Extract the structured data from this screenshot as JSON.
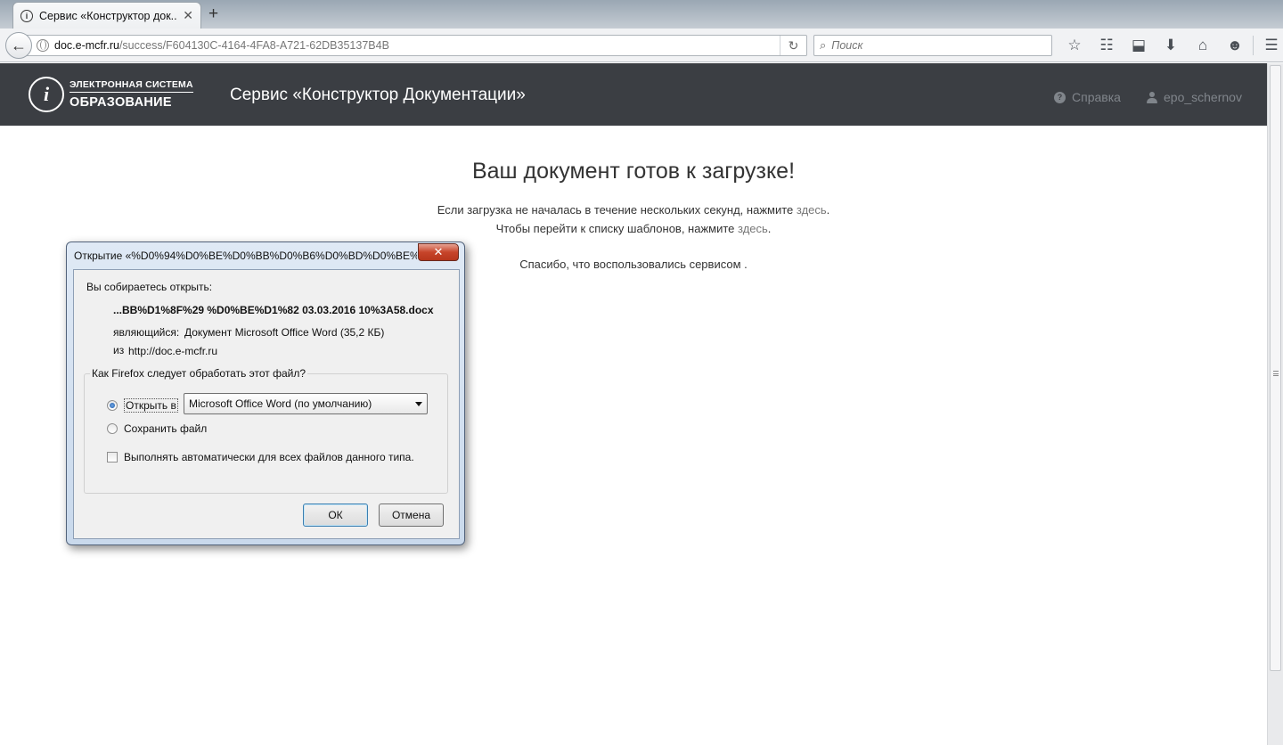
{
  "browser": {
    "tab_title": "Сервис «Конструктор док...",
    "tab_close": "✕",
    "new_tab": "+",
    "url_host": "doc.e-mcfr.ru",
    "url_path": "/success/F604130C-4164-4FA8-A721-62DB35137B4B",
    "search_placeholder": "Поиск",
    "icons": [
      "bookmark-star-icon",
      "reading-list-icon",
      "pocket-icon",
      "download-icon",
      "home-icon",
      "chat-icon",
      "menu-icon"
    ]
  },
  "header": {
    "logo_line1": "ЭЛЕКТРОННАЯ СИСТЕМА",
    "logo_line2": "ОБРАЗОВАНИЕ",
    "logo_mark": "i",
    "site_title": "Сервис «Конструктор Документации»",
    "help_label": "Справка",
    "user_label": "epo_schernov",
    "background": "#3b3e43"
  },
  "main": {
    "heading": "Ваш документ готов к загрузке!",
    "line1_text": "Если загрузка не началась в течение нескольких секунд, нажмите",
    "line1_link": "здесь",
    "line2_text": "Чтобы перейти к списку шаблонов, нажмите",
    "line2_link": "здесь",
    "line3_text": "Спасибо, что воспользовались сервисом ."
  },
  "dialog": {
    "title": "Открытие «%D0%94%D0%BE%D0%BB%D0%B6%D0%BD%D0%BE%D1...",
    "close": "✕",
    "intro": "Вы собираетесь открыть:",
    "filename": "...BB%D1%8F%29 %D0%BE%D1%82 03.03.2016 10%3A58.docx",
    "type_label": "являющийся:",
    "type_value": "Документ Microsoft Office Word (35,2 КБ)",
    "from_label": "из",
    "from_value": "http://doc.e-mcfr.ru",
    "group_legend": "Как Firefox следует обработать этот файл?",
    "open_with_label": "Открыть в",
    "open_with_value": "Microsoft Office Word (по умолчанию)",
    "save_label": "Сохранить файл",
    "auto_label": "Выполнять автоматически для всех файлов данного типа.",
    "ok_label": "ОК",
    "cancel_label": "Отмена"
  }
}
